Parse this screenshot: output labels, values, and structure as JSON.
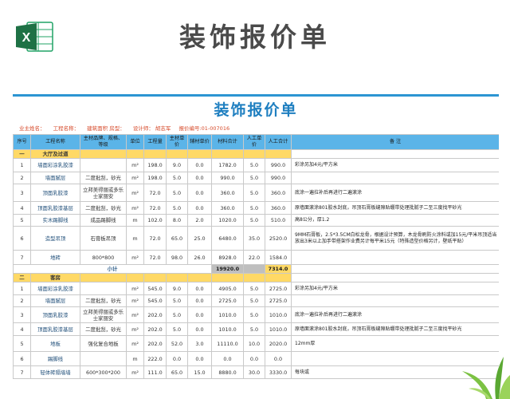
{
  "banner_title": "装饰报价单",
  "sheet": {
    "title": "装饰报价单",
    "info": [
      "业主姓名：",
      "工程名称：",
      "建筑面积 房型：",
      "设计师： 胡志军",
      "报价编号:01-007016"
    ]
  },
  "headers": [
    "序号",
    "工程名称",
    "主材品牌、规格、等级",
    "单位",
    "工程量",
    "主材单价",
    "辅材单价",
    "材料合计",
    "人工单价",
    "人工合计",
    "备 注"
  ],
  "sections": [
    {
      "no": "一",
      "name": "大厅及过道",
      "rows": [
        {
          "no": "1",
          "name": "墙面彩涂乳胶漆",
          "spec": "",
          "unit": "m²",
          "qty": "198.0",
          "main": "9.0",
          "aux": "0.0",
          "mat": "1782.0",
          "labor": "5.0",
          "ltotal": "990.0",
          "remark": "彩涂另加4元/平方米",
          "h": 17
        },
        {
          "no": "2",
          "name": "墙面腻层",
          "spec": "二度批刮，砂光",
          "unit": "m²",
          "qty": "198.0",
          "main": "5.0",
          "aux": "0.0",
          "mat": "990.0",
          "labor": "5.0",
          "ltotal": "990.0",
          "remark": "",
          "h": 15
        },
        {
          "no": "3",
          "name": "顶面乳胶漆",
          "spec": "立邦美得丽或多乐士家丽安",
          "unit": "m²",
          "qty": "72.0",
          "main": "5.0",
          "aux": "0.0",
          "mat": "360.0",
          "labor": "5.0",
          "ltotal": "360.0",
          "remark": "底涂一遍拉补后再进行二遍滚涂",
          "h": 22
        },
        {
          "no": "4",
          "name": "顶面乳胶漆基层",
          "spec": "二度批刮，砂光",
          "unit": "m²",
          "qty": "72.0",
          "main": "5.0",
          "aux": "0.0",
          "mat": "360.0",
          "labor": "5.0",
          "ltotal": "360.0",
          "remark": "原墙面滚涂801胶水封底，吊顶石膏板缝隙贴绷带处理批腻子二至三度找平砂光",
          "h": 16
        },
        {
          "no": "5",
          "name": "实木踢脚线",
          "spec": "成品踢脚线",
          "unit": "m",
          "qty": "102.0",
          "main": "8.0",
          "aux": "2.0",
          "mat": "1020.0",
          "labor": "5.0",
          "ltotal": "510.0",
          "remark": "高8公分，厚1.2",
          "h": 15
        },
        {
          "no": "6",
          "name": "造型吊顶",
          "spec": "石膏板吊顶",
          "unit": "m",
          "qty": "72.0",
          "main": "65.0",
          "aux": "25.0",
          "mat": "6480.0",
          "labor": "35.0",
          "ltotal": "2520.0",
          "remark": "9MM石膏板，2.5*3.5CM白松龙骨，根据设计预算，木龙骨刷防火涂料或加15元/平米吊顶适当放出3米以上加手带搭架作业费另计每平米15元（特殊造型价格另计，壁纸平贴）",
          "h": 30
        },
        {
          "no": "7",
          "name": "地砖",
          "spec": "800*800",
          "unit": "m²",
          "qty": "72.0",
          "main": "98.0",
          "aux": "26.0",
          "mat": "8928.0",
          "labor": "22.0",
          "ltotal": "1584.0",
          "remark": "",
          "h": 18
        }
      ],
      "subtotal": {
        "label": "小计",
        "mat": "19920.0",
        "ltotal": "7314.0"
      }
    },
    {
      "no": "二",
      "name": "客房",
      "rows": [
        {
          "no": "1",
          "name": "墙面彩涂乳胶漆",
          "spec": "",
          "unit": "m²",
          "qty": "545.0",
          "main": "9.0",
          "aux": "0.0",
          "mat": "4905.0",
          "labor": "5.0",
          "ltotal": "2725.0",
          "remark": "彩涂另加4元/平方米",
          "h": 16
        },
        {
          "no": "2",
          "name": "墙面腻层",
          "spec": "二度批刮，砂光",
          "unit": "m²",
          "qty": "545.0",
          "main": "5.0",
          "aux": "0.0",
          "mat": "2725.0",
          "labor": "5.0",
          "ltotal": "2725.0",
          "remark": "",
          "h": 15
        },
        {
          "no": "3",
          "name": "顶面乳胶漆",
          "spec": "立邦美得丽或多乐士家丽安",
          "unit": "m²",
          "qty": "202.0",
          "main": "5.0",
          "aux": "0.0",
          "mat": "1010.0",
          "labor": "5.0",
          "ltotal": "1010.0",
          "remark": "底涂一遍拉补后再进行二遍滚涂",
          "h": 20
        },
        {
          "no": "4",
          "name": "顶面乳胶漆基层",
          "spec": "二度批刮，砂光",
          "unit": "m²",
          "qty": "202.0",
          "main": "5.0",
          "aux": "0.0",
          "mat": "1010.0",
          "labor": "5.0",
          "ltotal": "1010.0",
          "remark": "原墙面滚涂801胶水封底，吊顶石膏板缝隙贴绷带处理批腻子二至三度找平砂光",
          "h": 16
        },
        {
          "no": "5",
          "name": "地板",
          "spec": "强化复合地板",
          "unit": "m²",
          "qty": "202.0",
          "main": "52.0",
          "aux": "3.0",
          "mat": "11110.0",
          "labor": "10.0",
          "ltotal": "2020.0",
          "remark": "12mm厚",
          "h": 20
        },
        {
          "no": "6",
          "name": "踢脚线",
          "spec": "",
          "unit": "m",
          "qty": "222.0",
          "main": "0.0",
          "aux": "0.0",
          "mat": "0.0",
          "labor": "0.0",
          "ltotal": "0.0",
          "remark": "",
          "h": 18
        },
        {
          "no": "7",
          "name": "轻体砖隔墙墙",
          "spec": "600*300*200",
          "unit": "m²",
          "qty": "111.0",
          "main": "65.0",
          "aux": "15.0",
          "mat": "8880.0",
          "labor": "30.0",
          "ltotal": "3330.0",
          "remark": "每块或",
          "h": 16
        }
      ]
    }
  ]
}
